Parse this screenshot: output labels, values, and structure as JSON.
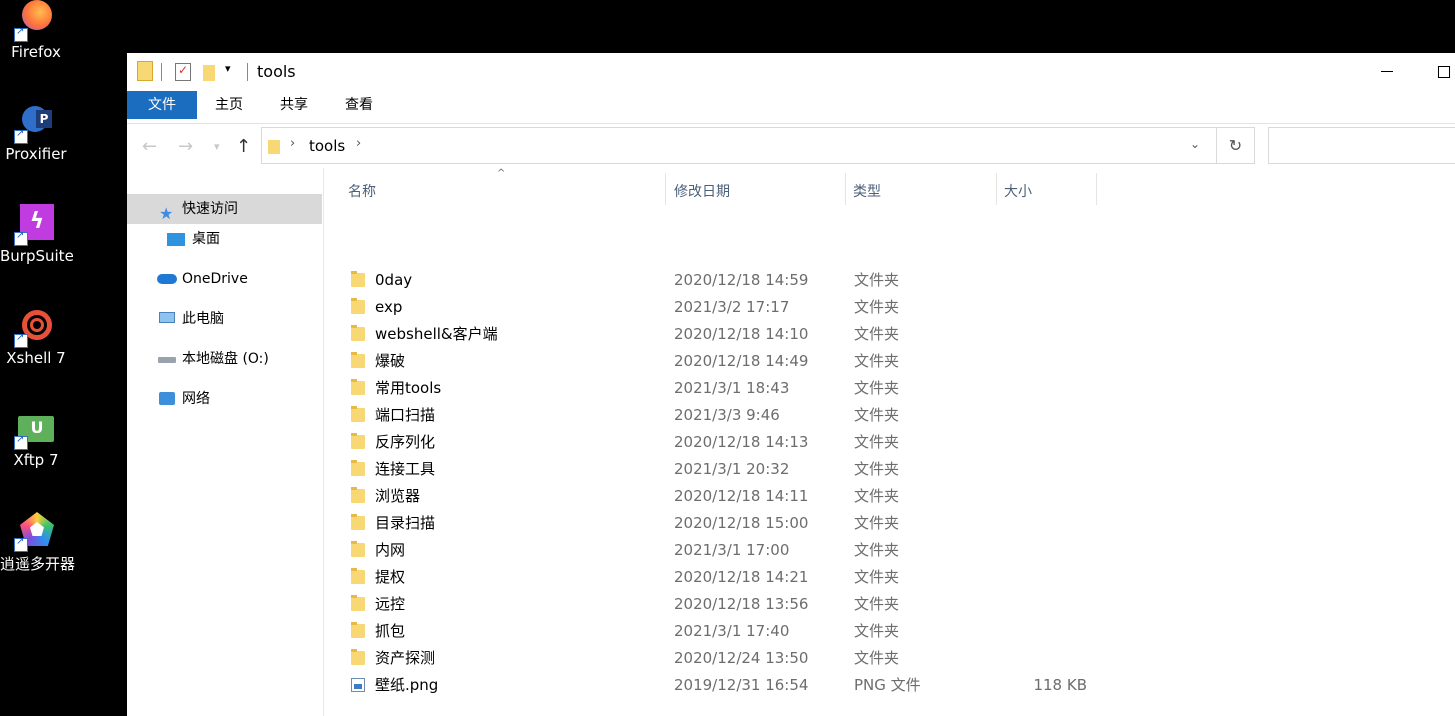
{
  "desktop": {
    "icons": [
      {
        "label": "Firefox",
        "icon": "firefox-icon",
        "color": "#ff7139"
      },
      {
        "label": "Proxifier",
        "icon": "proxifier-icon",
        "color": "#2f6fc9"
      },
      {
        "label": "BurpSuite",
        "icon": "burpsuite-icon",
        "color": "#c03be0"
      },
      {
        "label": "Xshell 7",
        "icon": "xshell-icon",
        "color": "#e8503a"
      },
      {
        "label": "Xftp 7",
        "icon": "xftp-icon",
        "color": "#5fb05a"
      },
      {
        "label": "逍遥多开器",
        "icon": "xiaoyao-icon",
        "color": "#7a4fe0"
      }
    ]
  },
  "window": {
    "title": "tools",
    "ribbon": {
      "tabs": [
        "文件",
        "主页",
        "共享",
        "查看"
      ]
    },
    "address": {
      "path": "tools"
    },
    "nav_pane": {
      "items": [
        {
          "label": "快速访问",
          "icon": "star-icon"
        },
        {
          "label": "桌面",
          "icon": "desktop-icon"
        },
        {
          "label": "OneDrive",
          "icon": "cloud-icon"
        },
        {
          "label": "此电脑",
          "icon": "computer-icon"
        },
        {
          "label": "本地磁盘 (O:)",
          "icon": "drive-icon"
        },
        {
          "label": "网络",
          "icon": "network-icon"
        }
      ]
    },
    "columns": {
      "name": "名称",
      "date": "修改日期",
      "type": "类型",
      "size": "大小"
    },
    "files": [
      {
        "name": "0day",
        "date": "2020/12/18 14:59",
        "type": "文件夹",
        "size": "",
        "kind": "folder"
      },
      {
        "name": "exp",
        "date": "2021/3/2 17:17",
        "type": "文件夹",
        "size": "",
        "kind": "folder"
      },
      {
        "name": "webshell&客户端",
        "date": "2020/12/18 14:10",
        "type": "文件夹",
        "size": "",
        "kind": "folder"
      },
      {
        "name": "爆破",
        "date": "2020/12/18 14:49",
        "type": "文件夹",
        "size": "",
        "kind": "folder"
      },
      {
        "name": "常用tools",
        "date": "2021/3/1 18:43",
        "type": "文件夹",
        "size": "",
        "kind": "folder"
      },
      {
        "name": "端口扫描",
        "date": "2021/3/3 9:46",
        "type": "文件夹",
        "size": "",
        "kind": "folder"
      },
      {
        "name": "反序列化",
        "date": "2020/12/18 14:13",
        "type": "文件夹",
        "size": "",
        "kind": "folder"
      },
      {
        "name": "连接工具",
        "date": "2021/3/1 20:32",
        "type": "文件夹",
        "size": "",
        "kind": "folder"
      },
      {
        "name": "浏览器",
        "date": "2020/12/18 14:11",
        "type": "文件夹",
        "size": "",
        "kind": "folder"
      },
      {
        "name": "目录扫描",
        "date": "2020/12/18 15:00",
        "type": "文件夹",
        "size": "",
        "kind": "folder"
      },
      {
        "name": "内网",
        "date": "2021/3/1 17:00",
        "type": "文件夹",
        "size": "",
        "kind": "folder"
      },
      {
        "name": "提权",
        "date": "2020/12/18 14:21",
        "type": "文件夹",
        "size": "",
        "kind": "folder"
      },
      {
        "name": "远控",
        "date": "2020/12/18 13:56",
        "type": "文件夹",
        "size": "",
        "kind": "folder"
      },
      {
        "name": "抓包",
        "date": "2021/3/1 17:40",
        "type": "文件夹",
        "size": "",
        "kind": "folder"
      },
      {
        "name": "资产探测",
        "date": "2020/12/24 13:50",
        "type": "文件夹",
        "size": "",
        "kind": "folder"
      },
      {
        "name": "壁纸.png",
        "date": "2019/12/31 16:54",
        "type": "PNG 文件",
        "size": "118 KB",
        "kind": "image"
      }
    ]
  }
}
